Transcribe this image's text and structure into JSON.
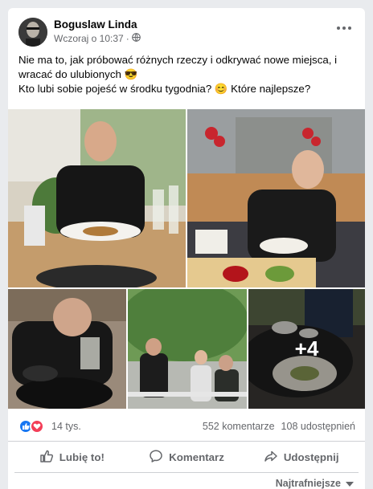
{
  "post": {
    "author": "Boguslaw Linda",
    "time": "Wczoraj o 10:37",
    "separator": "·",
    "privacy_icon": "globe-icon",
    "text_line1": "Nie ma to, jak próbować różnych rzeczy i odkrywać nowe miejsca, i",
    "text_line2": "wracać do ulubionych 😎",
    "text_line3": "Kto lubi sobie pojeść w środku tygodnia? 😊 Które najlepsze?"
  },
  "photos": {
    "more_count": "+4"
  },
  "stats": {
    "reactions_count": "14 tys.",
    "comments": "552 komentarze",
    "shares": "108 udostępnień"
  },
  "actions": {
    "like": "Lubię to!",
    "comment": "Komentarz",
    "share": "Udostępnij"
  },
  "sort": {
    "label": "Najtrafniejsze"
  },
  "colors": {
    "like_blue": "#1877f2",
    "love_red": "#f33e58",
    "secondary_text": "#65676b"
  }
}
